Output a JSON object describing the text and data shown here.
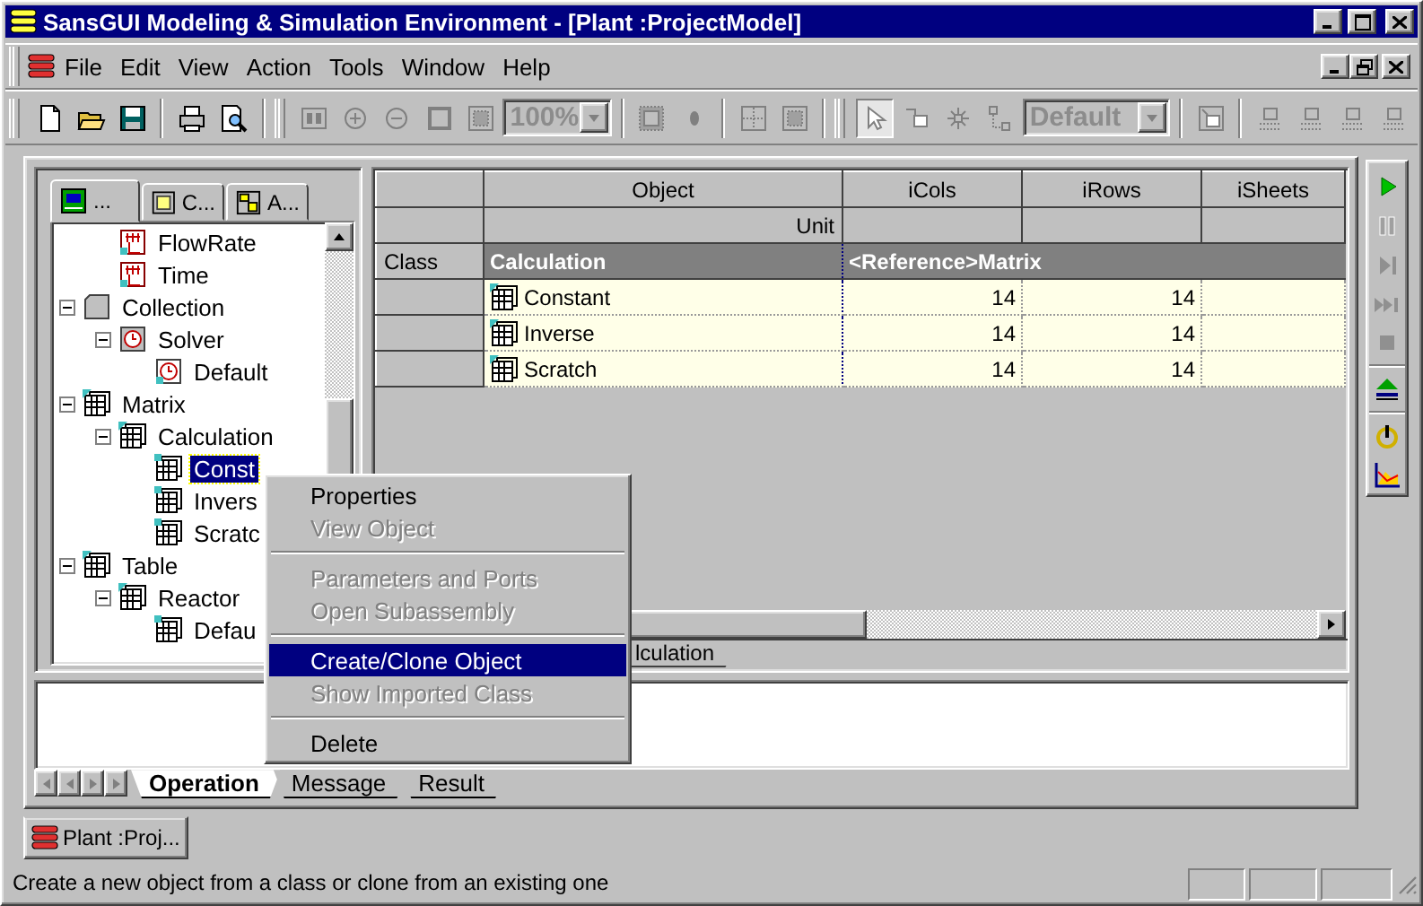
{
  "window": {
    "title": "SansGUI Modeling & Simulation Environment - [Plant :ProjectModel]"
  },
  "menu": [
    "File",
    "Edit",
    "View",
    "Action",
    "Tools",
    "Window",
    "Help"
  ],
  "toolbar": [
    {
      "kind": "grip"
    },
    {
      "kind": "new",
      "disabled": false,
      "pressed": false
    },
    {
      "kind": "open",
      "disabled": false,
      "pressed": false
    },
    {
      "kind": "save",
      "disabled": false,
      "pressed": false
    },
    {
      "kind": "separator"
    },
    {
      "kind": "print",
      "disabled": false,
      "pressed": false
    },
    {
      "kind": "preview",
      "disabled": false,
      "pressed": false
    },
    {
      "kind": "separator"
    },
    {
      "kind": "grip"
    },
    {
      "kind": "fit",
      "disabled": true,
      "pressed": false
    },
    {
      "kind": "zoom-in",
      "disabled": true,
      "pressed": false
    },
    {
      "kind": "zoom-out",
      "disabled": true,
      "pressed": false
    },
    {
      "kind": "frame",
      "disabled": true,
      "pressed": false
    },
    {
      "kind": "frame-fill",
      "disabled": true,
      "pressed": false
    },
    {
      "kind": "combo",
      "value": "100%",
      "disabled": true
    },
    {
      "kind": "separator"
    },
    {
      "kind": "grid-a",
      "disabled": true,
      "pressed": false
    },
    {
      "kind": "dot",
      "disabled": true,
      "pressed": false
    },
    {
      "kind": "separator"
    },
    {
      "kind": "grid-b",
      "disabled": true,
      "pressed": false
    },
    {
      "kind": "frame-fill",
      "disabled": true,
      "pressed": false
    },
    {
      "kind": "separator"
    },
    {
      "kind": "grip"
    },
    {
      "kind": "pointer",
      "disabled": true,
      "pressed": true
    },
    {
      "kind": "node",
      "disabled": true,
      "pressed": false
    },
    {
      "kind": "star",
      "disabled": true,
      "pressed": false
    },
    {
      "kind": "connect",
      "disabled": true,
      "pressed": false
    },
    {
      "kind": "combo",
      "value": "Default",
      "disabled": true
    },
    {
      "kind": "separator"
    },
    {
      "kind": "box",
      "disabled": true,
      "pressed": false
    },
    {
      "kind": "separator"
    },
    {
      "kind": "align",
      "disabled": true,
      "pressed": false
    },
    {
      "kind": "align",
      "disabled": true,
      "pressed": false
    },
    {
      "kind": "align",
      "disabled": true,
      "pressed": false
    },
    {
      "kind": "align",
      "disabled": true,
      "pressed": false
    }
  ],
  "explorer": {
    "tabs": [
      {
        "label": "...",
        "kind": "model",
        "selected": true
      },
      {
        "label": "C...",
        "kind": "class",
        "selected": false
      },
      {
        "label": "A...",
        "kind": "assembly",
        "selected": false
      }
    ],
    "tree": [
      {
        "children": [
          {
            "label": "FlowRate",
            "kind": "chart",
            "selected": false
          },
          {
            "label": "Time",
            "kind": "chart",
            "selected": false
          }
        ]
      },
      {
        "label": "Collection",
        "kind": "collection",
        "selected": false,
        "expanded": true,
        "children": [
          {
            "label": "Solver",
            "kind": "solver",
            "selected": false,
            "expanded": true,
            "children": [
              {
                "label": "Default",
                "kind": "solver-item",
                "selected": false
              }
            ]
          }
        ]
      },
      {
        "label": "Matrix",
        "kind": "matrix",
        "selected": false,
        "expanded": true,
        "children": [
          {
            "label": "Calculation",
            "kind": "matrix",
            "selected": false,
            "expanded": true,
            "children": [
              {
                "label": "Const",
                "kind": "matrix-item",
                "selected": true
              },
              {
                "label": "Invers",
                "kind": "matrix-item",
                "selected": false
              },
              {
                "label": "Scratc",
                "kind": "matrix-item",
                "selected": false
              }
            ]
          }
        ]
      },
      {
        "label": "Table",
        "kind": "matrix",
        "selected": false,
        "expanded": true,
        "children": [
          {
            "label": "Reactor",
            "kind": "matrix",
            "selected": false,
            "expanded": true,
            "children": [
              {
                "label": "Defau",
                "kind": "matrix-item",
                "selected": false
              }
            ]
          }
        ]
      }
    ]
  },
  "grid": {
    "columns": [
      "Object",
      "iCols",
      "iRows",
      "iSheets"
    ],
    "unit_label": "Unit",
    "class_row": {
      "header": "Class",
      "name": "Calculation",
      "reference": "<Reference>Matrix"
    },
    "rows": [
      {
        "object": "Constant",
        "icols": "14",
        "irows": "14"
      },
      {
        "object": "Inverse",
        "icols": "14",
        "irows": "14"
      },
      {
        "object": "Scratch",
        "icols": "14",
        "irows": "14"
      }
    ],
    "sheet_tabs": [
      {
        "label": "lculation",
        "selected": true
      }
    ]
  },
  "vertical_toolbar": [
    {
      "kind": "play",
      "disabled": false
    },
    {
      "kind": "pause",
      "disabled": true
    },
    {
      "kind": "step",
      "disabled": true
    },
    {
      "kind": "fast",
      "disabled": true
    },
    {
      "kind": "stop",
      "disabled": true
    },
    {
      "kind": "separator"
    },
    {
      "kind": "eject",
      "disabled": false
    },
    {
      "kind": "separator"
    },
    {
      "kind": "power",
      "disabled": false
    },
    {
      "kind": "plot",
      "disabled": false
    }
  ],
  "output_tabs": [
    {
      "label": "Operation",
      "selected": true
    },
    {
      "label": "Message",
      "selected": false
    },
    {
      "label": "Result",
      "selected": false
    }
  ],
  "context_menu": [
    {
      "kind": "item",
      "label": "Properties",
      "disabled": false,
      "selected": false
    },
    {
      "kind": "item",
      "label": "View Object",
      "disabled": true,
      "selected": false
    },
    {
      "kind": "separator"
    },
    {
      "kind": "item",
      "label": "Parameters and Ports",
      "disabled": true,
      "selected": false
    },
    {
      "kind": "item",
      "label": "Open Subassembly",
      "disabled": true,
      "selected": false
    },
    {
      "kind": "separator"
    },
    {
      "kind": "item",
      "label": "Create/Clone Object",
      "disabled": false,
      "selected": true
    },
    {
      "kind": "item",
      "label": "Show Imported Class",
      "disabled": true,
      "selected": false
    },
    {
      "kind": "separator"
    },
    {
      "kind": "item",
      "label": "Delete",
      "disabled": false,
      "selected": false
    }
  ],
  "task_tabs": [
    {
      "label": "Plant :Proj...",
      "selected": true
    }
  ],
  "status_bar": {
    "text": "Create a new object from a class or clone from an existing one"
  }
}
